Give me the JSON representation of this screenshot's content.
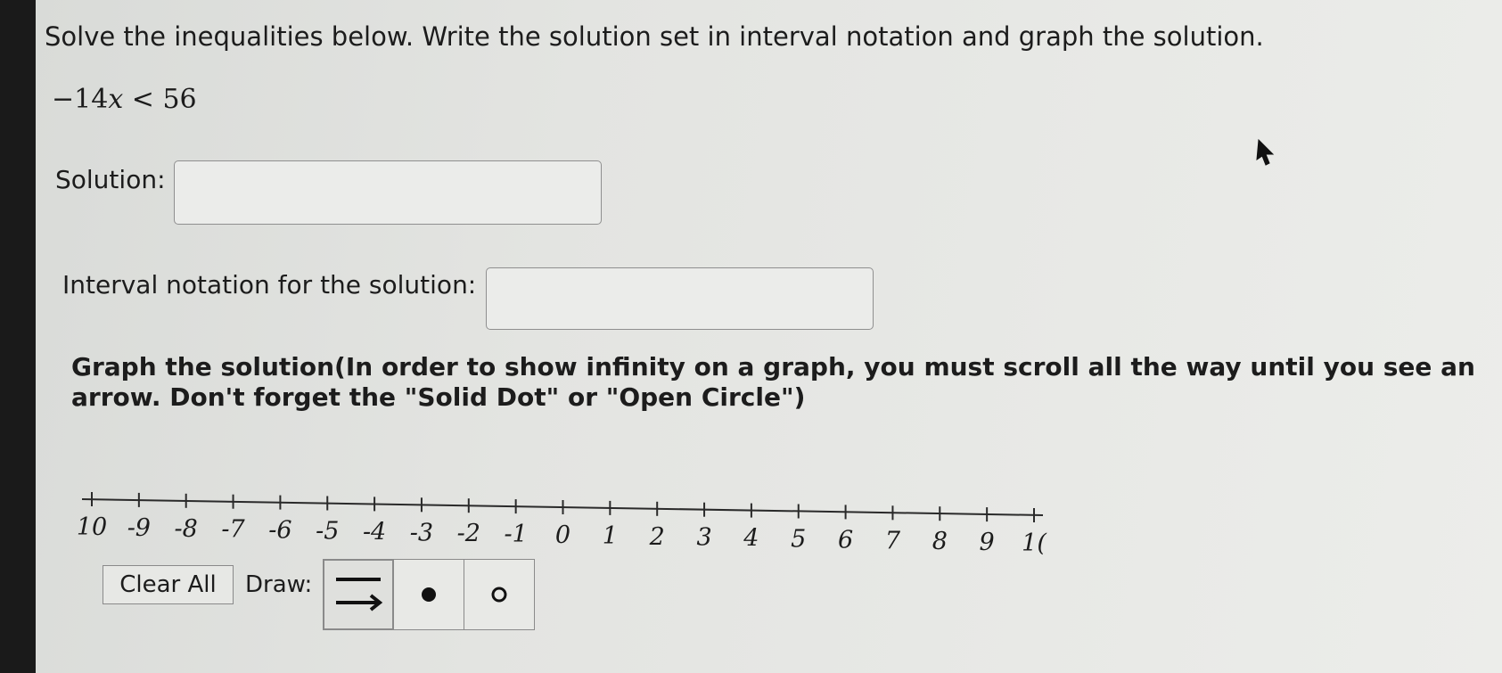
{
  "instructions": "Solve the inequalities below. Write the solution set in interval notation and graph the solution.",
  "equation": {
    "coefficient": "−14",
    "variable": "x",
    "relation": "<",
    "constant": "56"
  },
  "solution": {
    "label": "Solution:",
    "value": "",
    "placeholder": ""
  },
  "interval": {
    "label": "Interval notation for the solution:",
    "value": "",
    "placeholder": ""
  },
  "graph_instructions": "Graph the solution(In order to show infinity on a graph, you must scroll all the way until you see an arrow. Don't forget the \"Solid Dot\" or \"Open Circle\")",
  "number_line": {
    "ticks": [
      "10",
      "-9",
      "-8",
      "-7",
      "-6",
      "-5",
      "-4",
      "-3",
      "-2",
      "-1",
      "0",
      "1",
      "2",
      "3",
      "4",
      "5",
      "6",
      "7",
      "8",
      "9",
      "1("
    ]
  },
  "controls": {
    "clear_all_label": "Clear All",
    "draw_label": "Draw:",
    "tools": [
      {
        "name": "ray",
        "icon": "ray-arrow-icon"
      },
      {
        "name": "solid-dot",
        "icon": "solid-dot-icon"
      },
      {
        "name": "open-circle",
        "icon": "open-circle-icon"
      }
    ]
  },
  "colors": {
    "page_background": "#e4e5e2",
    "text": "#1c1c1c",
    "border": "#8a8a8a"
  }
}
